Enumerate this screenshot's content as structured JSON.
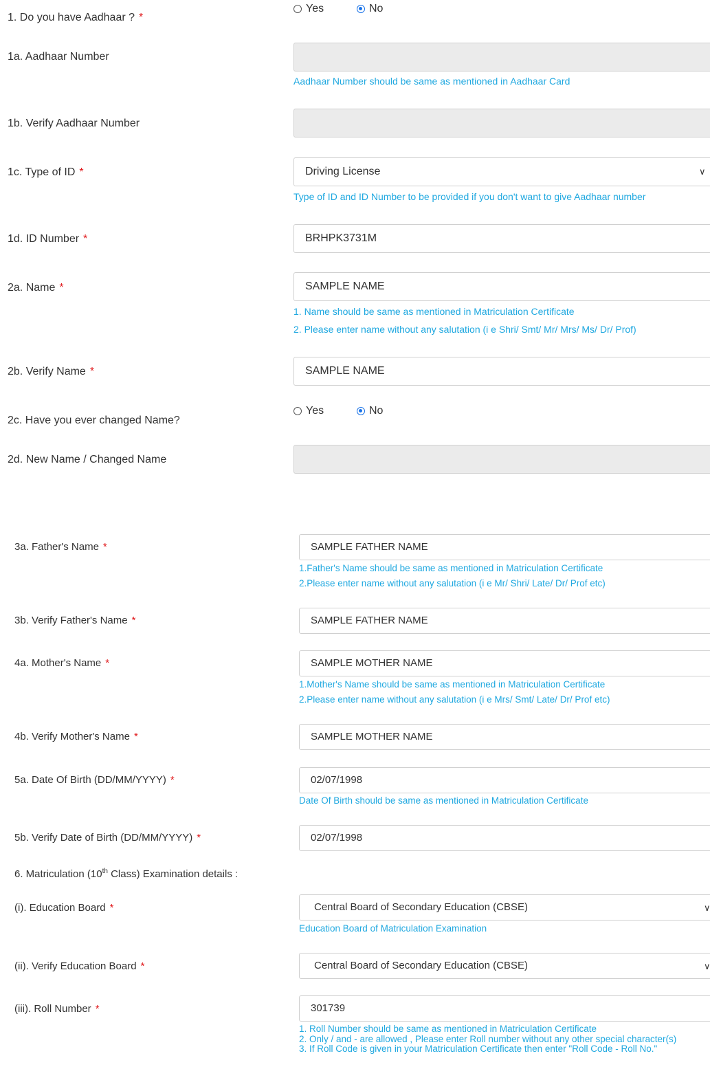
{
  "q1": {
    "label": "1. Do you have Aadhaar ?",
    "yes": "Yes",
    "no": "No",
    "selected": "No"
  },
  "q1a": {
    "label": "1a. Aadhaar Number",
    "value": "",
    "hint": "Aadhaar Number should be same as mentioned in Aadhaar Card"
  },
  "q1b": {
    "label": "1b. Verify Aadhaar Number",
    "value": ""
  },
  "q1c": {
    "label": "1c. Type of ID",
    "value": "Driving License",
    "hint": "Type of ID and ID Number to be provided if you don't want to give Aadhaar number"
  },
  "q1d": {
    "label": "1d. ID Number",
    "value": "BRHPK3731M"
  },
  "q2a": {
    "label": "2a. Name",
    "value": "SAMPLE NAME",
    "hint1": "1. Name should be same as mentioned in Matriculation Certificate",
    "hint2": "2. Please enter name without any salutation (i e Shri/ Smt/ Mr/ Mrs/ Ms/ Dr/ Prof)"
  },
  "q2b": {
    "label": "2b. Verify Name",
    "value": "SAMPLE NAME"
  },
  "q2c": {
    "label": "2c. Have you ever changed Name?",
    "yes": "Yes",
    "no": "No",
    "selected": "No"
  },
  "q2d": {
    "label": "2d. New Name / Changed Name",
    "value": ""
  },
  "q3a": {
    "label": "3a. Father's Name",
    "value": "SAMPLE FATHER NAME",
    "hint1": "1.Father's Name should be same as mentioned in Matriculation Certificate",
    "hint2": "2.Please enter name without any salutation (i e Mr/ Shri/ Late/ Dr/ Prof etc)"
  },
  "q3b": {
    "label": "3b. Verify Father's Name",
    "value": "SAMPLE FATHER NAME"
  },
  "q4a": {
    "label": "4a. Mother's Name",
    "value": "SAMPLE MOTHER NAME",
    "hint1": "1.Mother's Name should be same as mentioned in Matriculation Certificate",
    "hint2": "2.Please enter name without any salutation (i e Mrs/ Smt/ Late/ Dr/ Prof etc)"
  },
  "q4b": {
    "label": "4b. Verify Mother's Name",
    "value": "SAMPLE MOTHER NAME"
  },
  "q5a": {
    "label": "5a. Date Of Birth (DD/MM/YYYY)",
    "value": "02/07/1998",
    "hint": "Date Of Birth should be same as mentioned in Matriculation Certificate"
  },
  "q5b": {
    "label": "5b. Verify Date of Birth (DD/MM/YYYY)",
    "value": "02/07/1998"
  },
  "q6": {
    "label_pre": "6. Matriculation (10",
    "label_sup": "th",
    "label_post": " Class) Examination details :"
  },
  "q6i": {
    "label": "(i). Education Board",
    "value": "Central Board of Secondary Education (CBSE)",
    "hint": "Education Board of Matriculation Examination"
  },
  "q6ii": {
    "label": "(ii). Verify Education Board",
    "value": "Central Board of Secondary Education (CBSE)"
  },
  "q6iii": {
    "label": "(iii). Roll Number",
    "value": "301739",
    "hint1": "1. Roll Number should be same as mentioned in Matriculation Certificate",
    "hint2": "2. Only / and - are allowed , Please enter Roll number without any other special character(s)",
    "hint3": "3. If Roll Code is given in your Matriculation Certificate then enter \"Roll Code - Roll No.\""
  },
  "required_mark": "*",
  "colors": {
    "hint": "#1fa8e0",
    "required": "#e0181b",
    "radio_selected": "#1a73e8",
    "disabled_bg": "#ebebeb"
  },
  "icons": {
    "dropdown": "chevron-down-icon"
  }
}
